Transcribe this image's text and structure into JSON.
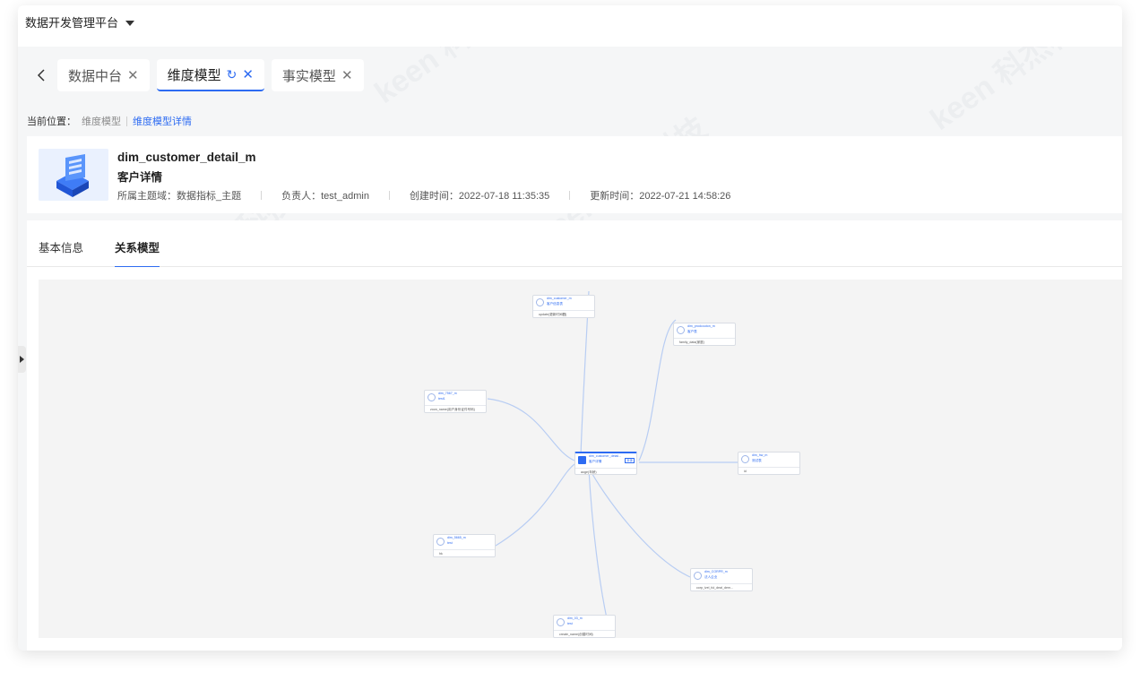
{
  "app": {
    "title": "数据开发管理平台"
  },
  "tabs": [
    {
      "label": "数据中台",
      "close": "✕"
    },
    {
      "label": "维度模型",
      "close": "✕",
      "refresh": "↻"
    },
    {
      "label": "事实模型",
      "close": "✕"
    }
  ],
  "breadcrumb": {
    "prefix": "当前位置：",
    "items": [
      "维度模型",
      "维度模型详情"
    ]
  },
  "model": {
    "name": "dim_customer_detail_m",
    "cn_name": "客户详情",
    "domain_label": "所属主题域：数据指标_主题",
    "owner_label": "负责人：test_admin",
    "created_label": "创建时间：2022-07-18 11:35:35",
    "updated_label": "更新时间：2022-07-21 14:58:26"
  },
  "detail_tabs": [
    "基本信息",
    "关系模型"
  ],
  "graph": {
    "nodes": [
      {
        "name": "dim_customer_detail...",
        "cn": "客户详情",
        "field": "aoge(年龄)",
        "tag": "本体"
      },
      {
        "name": "dim_customer_m",
        "cn": "客户信息表",
        "field": "update(更新时间戳)"
      },
      {
        "name": "dim_prodcouton_m",
        "cn": "客户表",
        "field": "family_data(家庭)"
      },
      {
        "name": "dim_7567_m",
        "cn": "test1",
        "field": "zoon_name(用户身份证件号码)"
      },
      {
        "name": "dim_hw_m",
        "cn": "测试表",
        "field": "id"
      },
      {
        "name": "dim_5665_m",
        "cn": "test",
        "field": "hk"
      },
      {
        "name": "dim_CORPR_m",
        "cn": "法人企业",
        "field": "corp_lvel_ful_deal_dem..."
      },
      {
        "name": "dim_03_m",
        "cn": "test",
        "field": "create_name(创建时间)"
      }
    ]
  },
  "watermark": "keen 科杰科技"
}
